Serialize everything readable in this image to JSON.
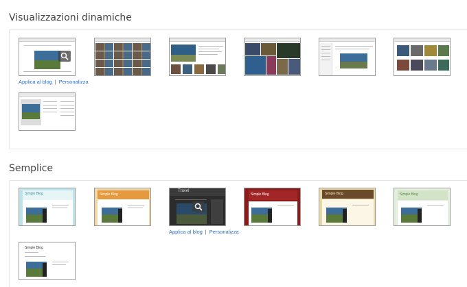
{
  "sections": [
    {
      "title": "Visualizzazioni dinamiche"
    },
    {
      "title": "Semplice"
    }
  ],
  "dynamic": {
    "links": {
      "apply": "Applica al blog",
      "customize": "Personalizza"
    }
  },
  "simple": {
    "thumb_titles": [
      "Simple Blog",
      "Simple Blog",
      "Travel",
      "Simple Blog",
      "Simple Blog",
      "Simple Blog",
      "Simple Blog"
    ],
    "links": {
      "apply": "Applica al blog",
      "customize": "Personalizza"
    }
  },
  "colors": {
    "link": "#2a6fd1",
    "panel_border": "#e6e6e6"
  }
}
